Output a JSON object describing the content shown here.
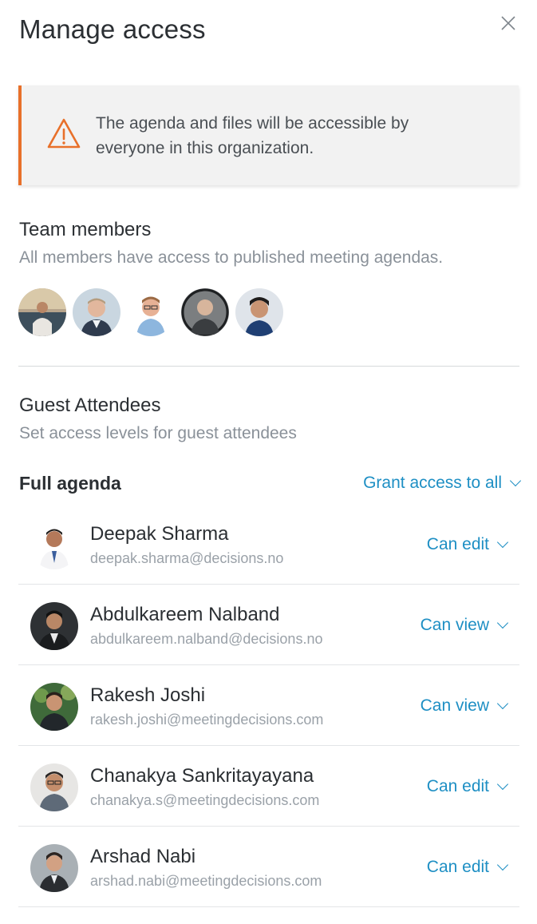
{
  "header": {
    "title": "Manage access"
  },
  "alert": {
    "message": "The agenda and files will be accessible by everyone in this organization."
  },
  "team": {
    "heading": "Team members",
    "subtext": "All members have access to published meeting agendas."
  },
  "guests": {
    "heading": "Guest Attendees",
    "subtext": "Set access levels for guest attendees"
  },
  "full_agenda": {
    "label": "Full agenda",
    "grant_all": "Grant access to all"
  },
  "attendees": [
    {
      "name": "Deepak Sharma",
      "email": "deepak.sharma@decisions.no",
      "permission": "Can edit"
    },
    {
      "name": "Abdulkareem Nalband",
      "email": "abdulkareem.nalband@decisions.no",
      "permission": "Can view"
    },
    {
      "name": "Rakesh Joshi",
      "email": "rakesh.joshi@meetingdecisions.com",
      "permission": "Can view"
    },
    {
      "name": "Chanakya Sankritayayana",
      "email": "chanakya.s@meetingdecisions.com",
      "permission": "Can edit"
    },
    {
      "name": "Arshad Nabi",
      "email": "arshad.nabi@meetingdecisions.com",
      "permission": "Can edit"
    }
  ],
  "colors": {
    "accent": "#1e8fc4",
    "warning": "#e8702a"
  }
}
